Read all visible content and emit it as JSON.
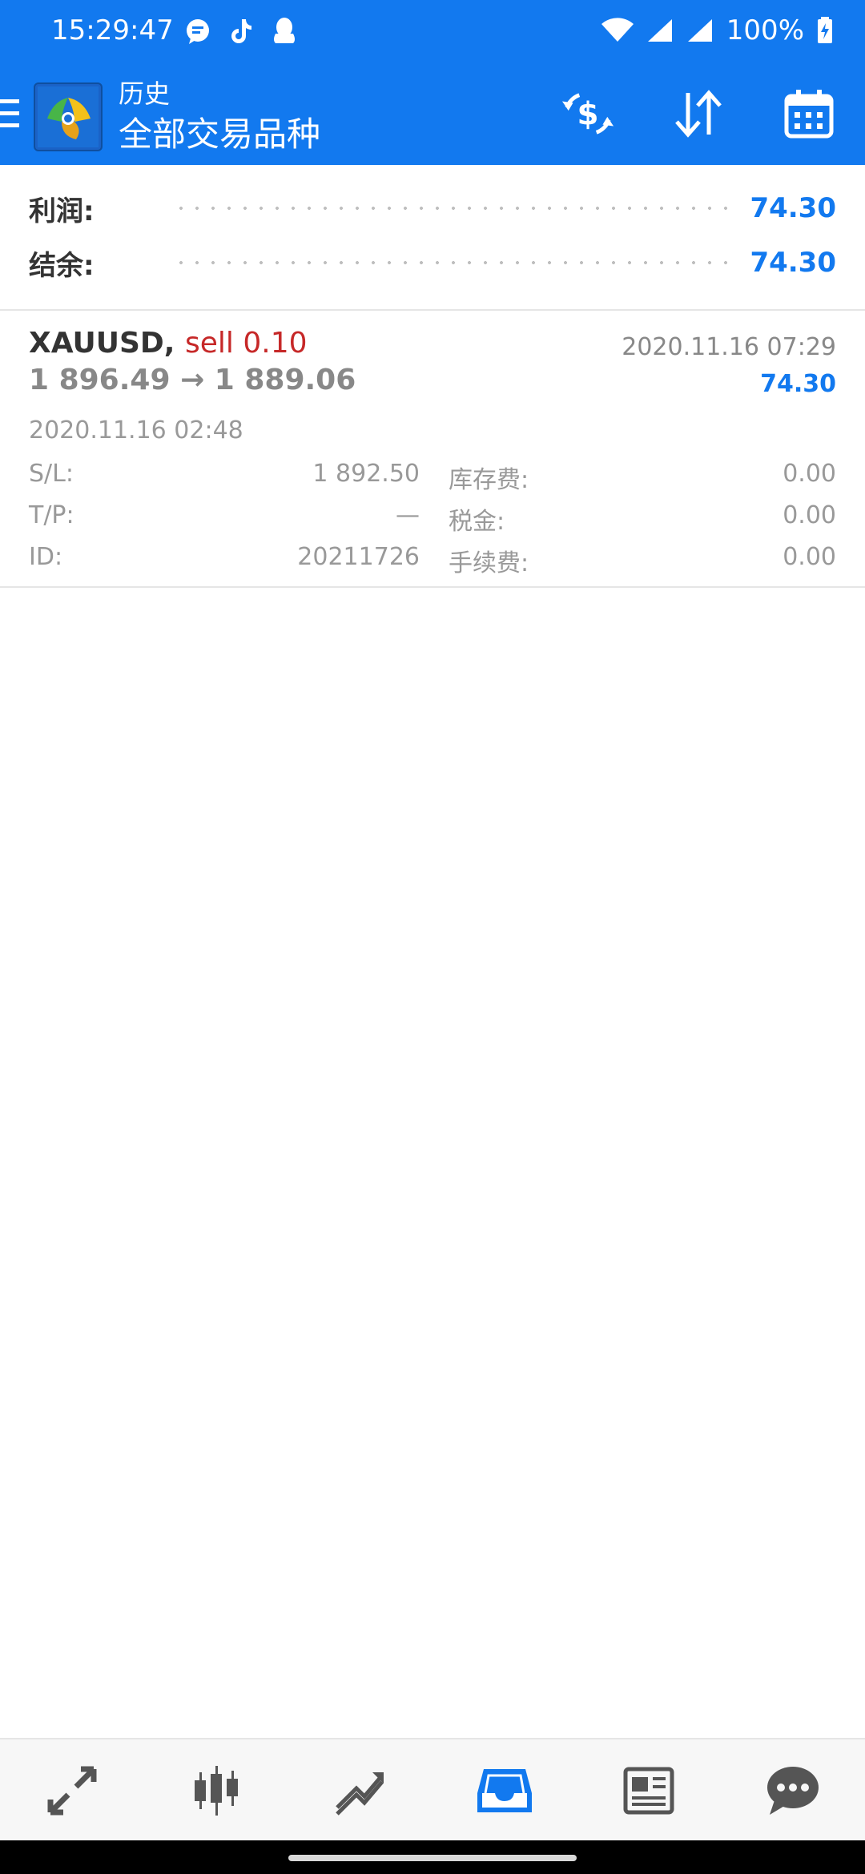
{
  "status_bar": {
    "time": "15:29:47",
    "battery": "100%",
    "icons": [
      "message-bubble-icon",
      "tiktok-icon",
      "qq-icon",
      "wifi-icon",
      "signal-icon",
      "signal-icon",
      "battery-charging-icon"
    ]
  },
  "header": {
    "subtitle": "历史",
    "title": "全部交易品种",
    "actions": [
      "currency-exchange-icon",
      "sort-icon",
      "calendar-icon"
    ]
  },
  "summary": {
    "profit_label": "利润:",
    "profit_value": "74.30",
    "balance_label": "结余:",
    "balance_value": "74.30"
  },
  "trade": {
    "symbol": "XAUUSD,",
    "side": "sell 0.10",
    "price_from": "1 896.49",
    "arrow": "→",
    "price_to": "1 889.06",
    "close_time": "2020.11.16 07:29",
    "profit": "74.30",
    "open_time": "2020.11.16 02:48",
    "sl_label": "S/L:",
    "sl_value": "1 892.50",
    "swap_label": "库存费:",
    "swap_value": "0.00",
    "tp_label": "T/P:",
    "tp_value": "—",
    "tax_label": "税金:",
    "tax_value": "0.00",
    "id_label": "ID:",
    "id_value": "20211726",
    "commission_label": "手续费:",
    "commission_value": "0.00"
  },
  "bottom_nav": {
    "items": [
      "quotes-icon",
      "chart-icon",
      "trade-icon",
      "history-icon",
      "news-icon",
      "chat-icon"
    ],
    "active_index": 3
  },
  "colors": {
    "primary": "#1279ef",
    "sell": "#c62828",
    "muted": "#999999"
  }
}
